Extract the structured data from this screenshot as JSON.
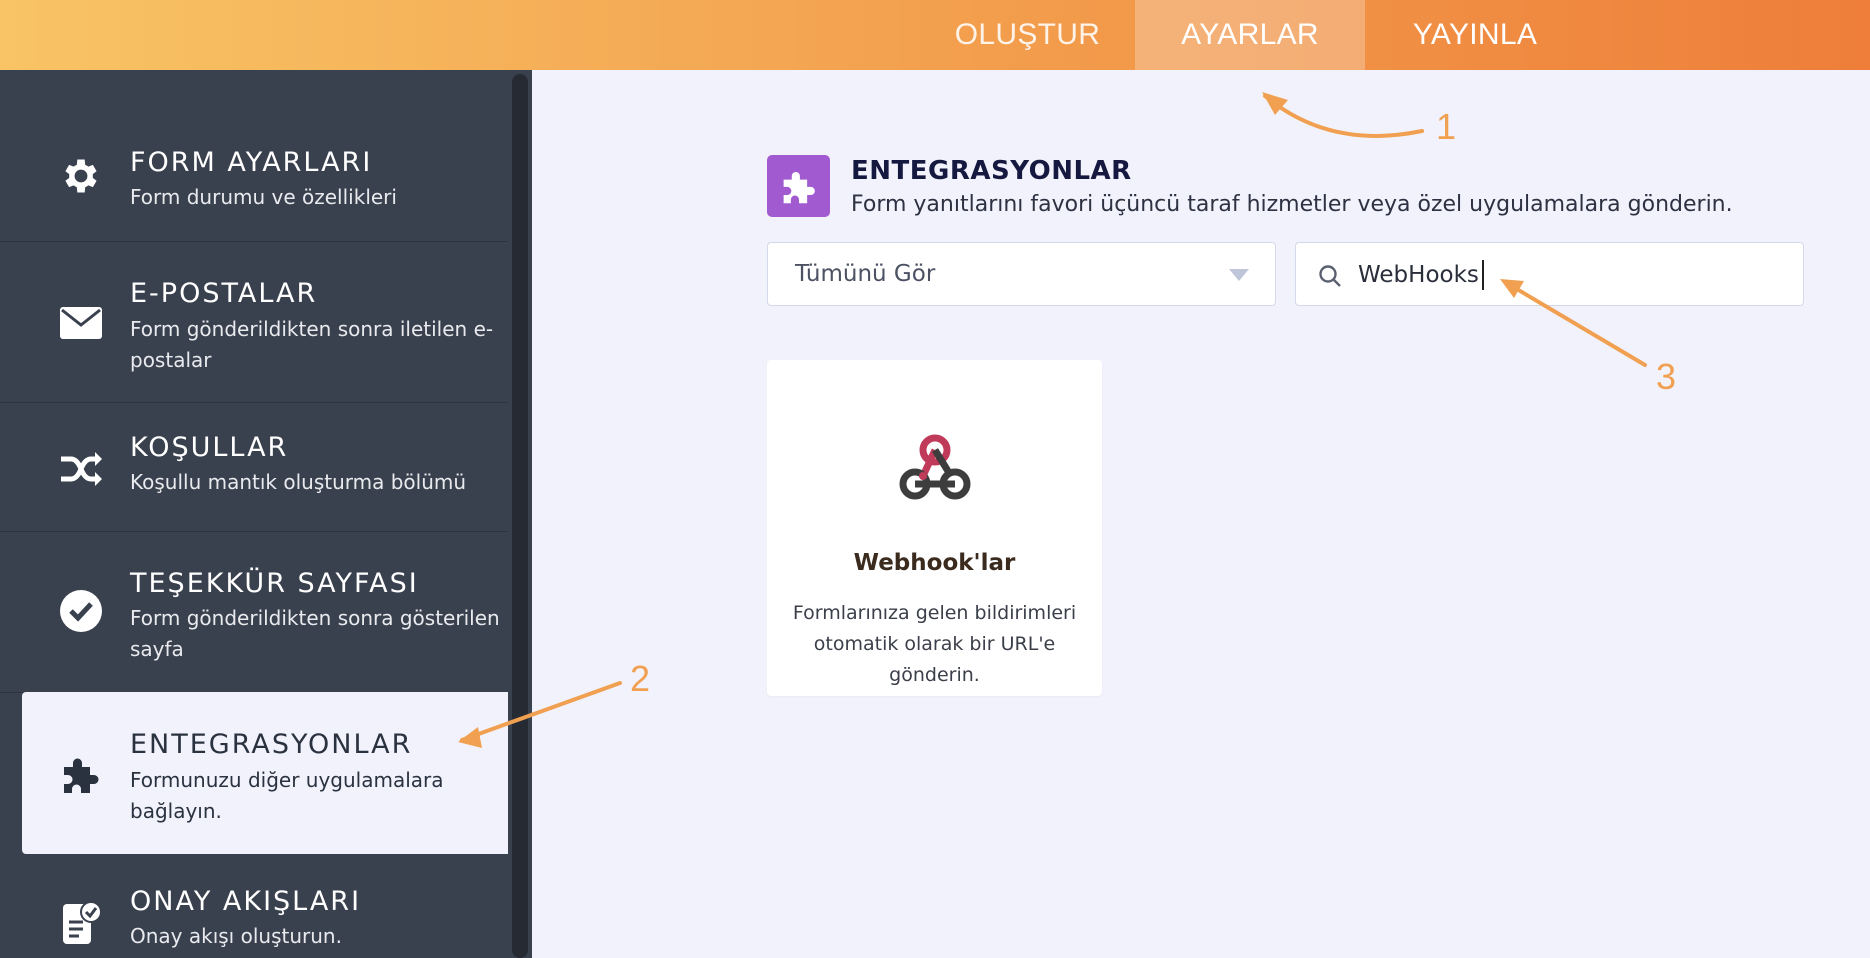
{
  "topbar": {
    "tabs": [
      {
        "label": "OLUŞTUR"
      },
      {
        "label": "AYARLAR"
      },
      {
        "label": "YAYINLA"
      }
    ]
  },
  "sidebar": {
    "items": [
      {
        "icon": "gear-icon",
        "title": "FORM AYARLARI",
        "desc": "Form durumu ve özellikleri"
      },
      {
        "icon": "envelope-icon",
        "title": "E-POSTALAR",
        "desc": "Form gönderildikten sonra iletilen e-postalar"
      },
      {
        "icon": "shuffle-icon",
        "title": "KOŞULLAR",
        "desc": "Koşullu mantık oluşturma bölümü"
      },
      {
        "icon": "check-circle-icon",
        "title": "TEŞEKKÜR SAYFASI",
        "desc": "Form gönderildikten sonra gösterilen sayfa"
      },
      {
        "icon": "puzzle-icon",
        "title": "ENTEGRASYONLAR",
        "desc": "Formunuzu diğer uygulamalara bağlayın."
      },
      {
        "icon": "approval-icon",
        "title": "ONAY AKIŞLARI",
        "desc": "Onay akışı oluşturun."
      }
    ]
  },
  "main": {
    "title": "ENTEGRASYONLAR",
    "desc": "Form yanıtlarını favori üçüncü taraf hizmetler veya özel uygulamalara gönderin.",
    "filter": {
      "selected": "Tümünü Gör"
    },
    "search": {
      "value": "WebHooks"
    },
    "cards": [
      {
        "icon": "webhook-icon",
        "name": "Webhook'lar",
        "desc": "Formlarınıza gelen bildirimleri otomatik olarak bir URL'e gönderin."
      }
    ]
  },
  "annotations": {
    "labels": [
      "1",
      "2",
      "3"
    ],
    "color": "#f0a050"
  },
  "colors": {
    "accent": "#ee7e3a",
    "sidebar_bg": "#3a414e",
    "integration_badge": "#a25ad0"
  }
}
